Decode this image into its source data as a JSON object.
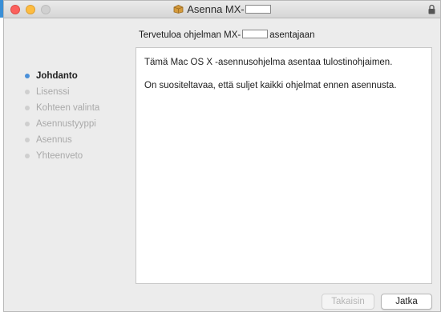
{
  "window": {
    "title_prefix": "Asenna MX-",
    "package_icon": "package-icon",
    "lock_icon": "lock-icon"
  },
  "heading": {
    "prefix": "Tervetuloa ohjelman MX-",
    "suffix": "asentajaan"
  },
  "steps": [
    {
      "label": "Johdanto",
      "active": true
    },
    {
      "label": "Lisenssi",
      "active": false
    },
    {
      "label": "Kohteen valinta",
      "active": false
    },
    {
      "label": "Asennustyyppi",
      "active": false
    },
    {
      "label": "Asennus",
      "active": false
    },
    {
      "label": "Yhteenveto",
      "active": false
    }
  ],
  "content": {
    "paragraphs": [
      "Tämä Mac OS X -asennusohjelma asentaa tulostinohjaimen.",
      "On suositeltavaa, että suljet kaikki ohjelmat ennen asennusta."
    ]
  },
  "buttons": {
    "back_label": "Takaisin",
    "next_label": "Jatka"
  },
  "colors": {
    "active_step": "#4a90d9",
    "close": "#fc605c",
    "minimize": "#fdbc40"
  }
}
